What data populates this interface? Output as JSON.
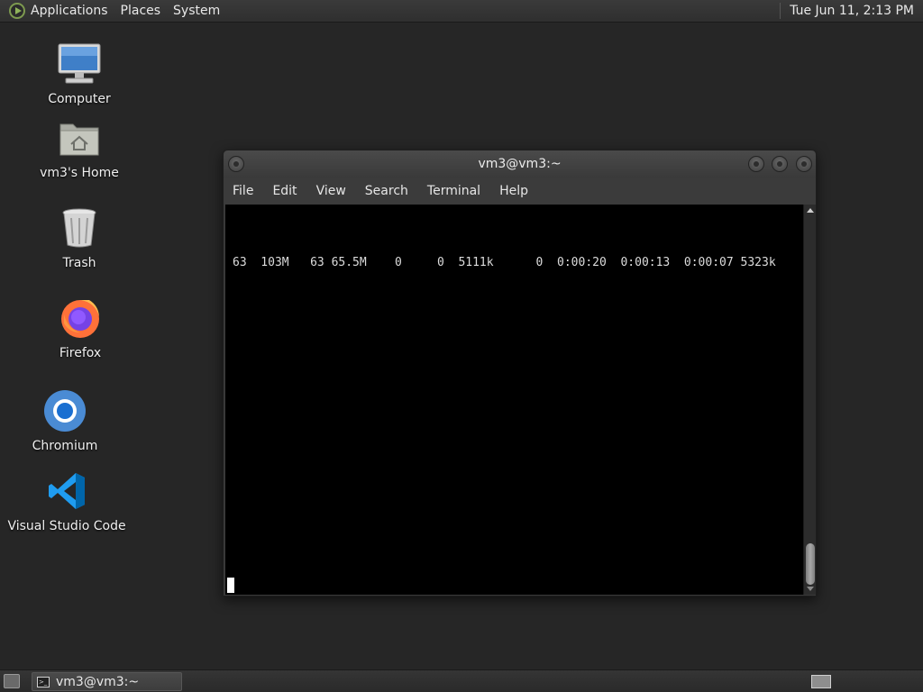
{
  "top_panel": {
    "menus": [
      "Applications",
      "Places",
      "System"
    ],
    "clock": "Tue Jun 11,  2:13 PM"
  },
  "desktop_icons": [
    {
      "label": "Computer",
      "icon": "computer-icon"
    },
    {
      "label": "vm3's Home",
      "icon": "home-folder-icon"
    },
    {
      "label": "Trash",
      "icon": "trash-icon"
    },
    {
      "label": "Firefox",
      "icon": "firefox-icon"
    },
    {
      "label": "Chromium",
      "icon": "chromium-icon"
    },
    {
      "label": "Visual Studio Code",
      "icon": "vscode-icon"
    }
  ],
  "terminal": {
    "title": "vm3@vm3:~",
    "menu": [
      "File",
      "Edit",
      "View",
      "Search",
      "Terminal",
      "Help"
    ],
    "output_line": "63  103M   63 65.5M    0     0  5111k      0  0:00:20  0:00:13  0:00:07 5323k"
  },
  "taskbar": {
    "task_label": "vm3@vm3:~"
  },
  "colors": {
    "desktop_bg": "#262626",
    "terminal_bg": "#000000",
    "accent_green": "#8fb35a"
  }
}
